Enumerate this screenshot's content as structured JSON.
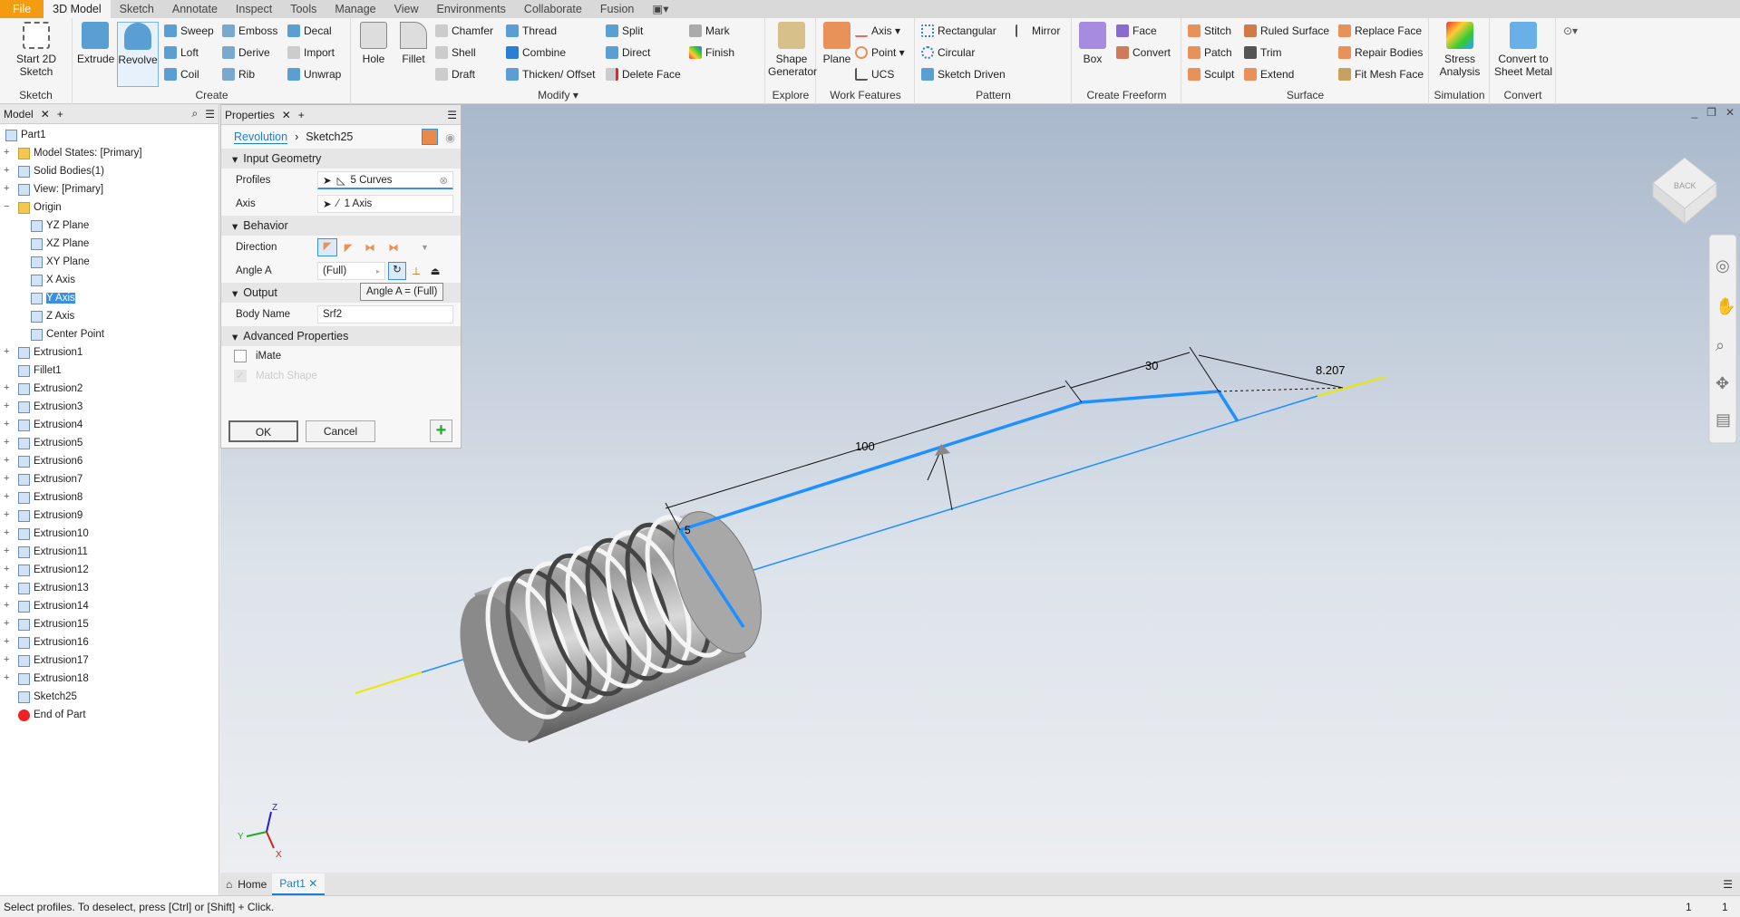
{
  "menu_tabs": [
    "File",
    "3D Model",
    "Sketch",
    "Annotate",
    "Inspect",
    "Tools",
    "Manage",
    "View",
    "Environments",
    "Collaborate",
    "Fusion"
  ],
  "ribbon": {
    "sketch": {
      "title": "Sketch",
      "start": "Start 2D Sketch"
    },
    "create": {
      "title": "Create",
      "extrude": "Extrude",
      "revolve": "Revolve",
      "small": [
        "Sweep",
        "Loft",
        "Coil",
        "Emboss",
        "Derive",
        "Rib",
        "Decal",
        "Import",
        "Unwrap"
      ]
    },
    "modify": {
      "title": "Modify ▾",
      "hole": "Hole",
      "fillet": "Fillet",
      "small": [
        "Chamfer",
        "Shell",
        "Draft",
        "Thread",
        "Combine",
        "Thicken/ Offset",
        "Split",
        "Direct",
        "Delete Face",
        "Mark",
        "Finish"
      ]
    },
    "explore": {
      "title": "Explore",
      "shape": "Shape Generator"
    },
    "work": {
      "title": "Work Features",
      "plane": "Plane",
      "small": [
        "Axis ▾",
        "Point ▾",
        "UCS"
      ]
    },
    "pattern": {
      "title": "Pattern",
      "small": [
        "Rectangular",
        "Circular",
        "Sketch Driven",
        "Mirror"
      ]
    },
    "freeform": {
      "title": "Create Freeform",
      "box": "Box",
      "small": [
        "Face",
        "Convert"
      ]
    },
    "surface": {
      "title": "Surface",
      "small": [
        "Stitch",
        "Patch",
        "Sculpt",
        "Ruled Surface",
        "Trim",
        "Extend",
        "Replace Face",
        "Repair Bodies",
        "Fit Mesh Face"
      ]
    },
    "simulation": {
      "title": "Simulation",
      "stress": "Stress Analysis"
    },
    "convert": {
      "title": "Convert",
      "sheet": "Convert to Sheet Metal"
    }
  },
  "browser": {
    "tab": "Model",
    "items": [
      "Part1",
      "Model States: [Primary]",
      "Solid Bodies(1)",
      "View: [Primary]",
      "Origin",
      "YZ Plane",
      "XZ Plane",
      "XY Plane",
      "X Axis",
      "Y Axis",
      "Z Axis",
      "Center Point",
      "Extrusion1",
      "Fillet1",
      "Extrusion2",
      "Extrusion3",
      "Extrusion4",
      "Extrusion5",
      "Extrusion6",
      "Extrusion7",
      "Extrusion8",
      "Extrusion9",
      "Extrusion10",
      "Extrusion11",
      "Extrusion12",
      "Extrusion13",
      "Extrusion14",
      "Extrusion15",
      "Extrusion16",
      "Extrusion17",
      "Extrusion18",
      "Sketch25",
      "End of Part"
    ]
  },
  "properties": {
    "tab": "Properties",
    "crumb1": "Revolution",
    "crumb2": "Sketch25",
    "input_geometry": "Input Geometry",
    "profiles_label": "Profiles",
    "profiles_value": "5 Curves",
    "axis_label": "Axis",
    "axis_value": "1 Axis",
    "behavior": "Behavior",
    "direction_label": "Direction",
    "angle_label": "Angle A",
    "angle_value": "(Full)",
    "tooltip": "Angle A = (Full)",
    "output": "Output",
    "body_label": "Body Name",
    "body_value": "Srf2",
    "advanced": "Advanced Properties",
    "imate": "iMate",
    "imate_checked": false,
    "match_shape": "Match Shape",
    "match_checked": true,
    "ok": "OK",
    "cancel": "Cancel"
  },
  "viewport": {
    "dims": [
      "100",
      "30",
      "8.207",
      "5"
    ],
    "viewcube_face": "BACK"
  },
  "doc_tabs": [
    "Home",
    "Part1"
  ],
  "status": {
    "text": "Select profiles. To deselect, press [Ctrl] or [Shift] + Click.",
    "n1": "1",
    "n2": "1"
  },
  "colors": {
    "accent": "#f39c12",
    "sketch_blue": "#1e90ff",
    "axis_yellow": "#e8e800"
  }
}
